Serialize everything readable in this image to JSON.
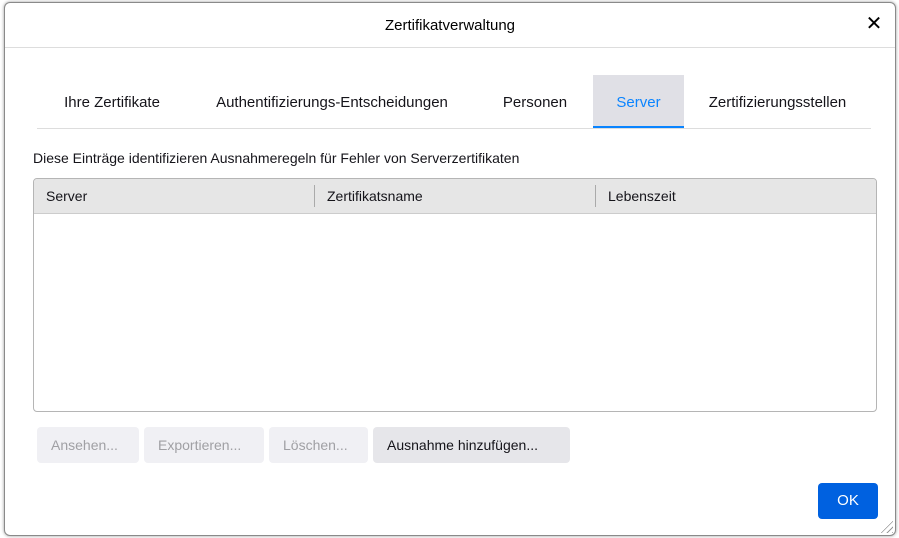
{
  "dialog": {
    "title": "Zertifikatverwaltung",
    "close_glyph": "✕"
  },
  "tabs": [
    {
      "label": "Ihre Zertifikate"
    },
    {
      "label": "Authentifizierungs-Entscheidungen"
    },
    {
      "label": "Personen"
    },
    {
      "label": "Server",
      "selected": true
    },
    {
      "label": "Zertifizierungsstellen"
    }
  ],
  "description": "Diese Einträge identifizieren Ausnahmeregeln für Fehler von Serverzertifikaten",
  "table": {
    "columns": [
      "Server",
      "Zertifikatsname",
      "Lebenszeit"
    ],
    "rows": []
  },
  "buttons": {
    "view": "Ansehen...",
    "export": "Exportieren...",
    "delete": "Löschen...",
    "add_exception": "Ausnahme hinzufügen...",
    "ok": "OK"
  },
  "colors": {
    "accent": "#0a84ff",
    "primary_button": "#0061e0"
  }
}
